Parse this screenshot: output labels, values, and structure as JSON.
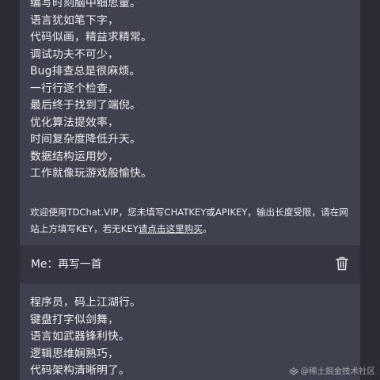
{
  "answer_top": {
    "lines": [
      "编写时刻脑中细思量。",
      "语言犹如笔下字，",
      "代码似画，精益求精常。",
      "调试功夫不可少，",
      "Bug排查总是很麻烦。",
      "一行行逐个检查，",
      "最后终于找到了端倪。",
      "优化算法提效率，",
      "时间复杂度降低升天。",
      "数据结构运用妙，",
      "工作就像玩游戏般愉快。"
    ],
    "notice_text": "欢迎使用TDChat.VIP，您未填写CHATKEY或APIKEY，输出长度受限，请在网站上方填写KEY，若无KEY",
    "notice_link": "请点击这里购买",
    "notice_end": "。"
  },
  "user_message": {
    "label": "Me：再写一首",
    "delete_icon": "trash-icon"
  },
  "answer_bottom": {
    "lines": [
      "程序员，码上江湖行。",
      "键盘打字似剑舞，",
      "语言如武器锋利快。",
      "逻辑思维娴熟巧，",
      "代码架构清晰明了。"
    ]
  },
  "watermark": {
    "text": "@稀土掘金技术社区",
    "icon": "juejin-logo-icon"
  },
  "colors": {
    "background": "#2b2c35",
    "answer_card": "#40414f",
    "user_bar": "#343541",
    "text": "#f0f0f2"
  }
}
